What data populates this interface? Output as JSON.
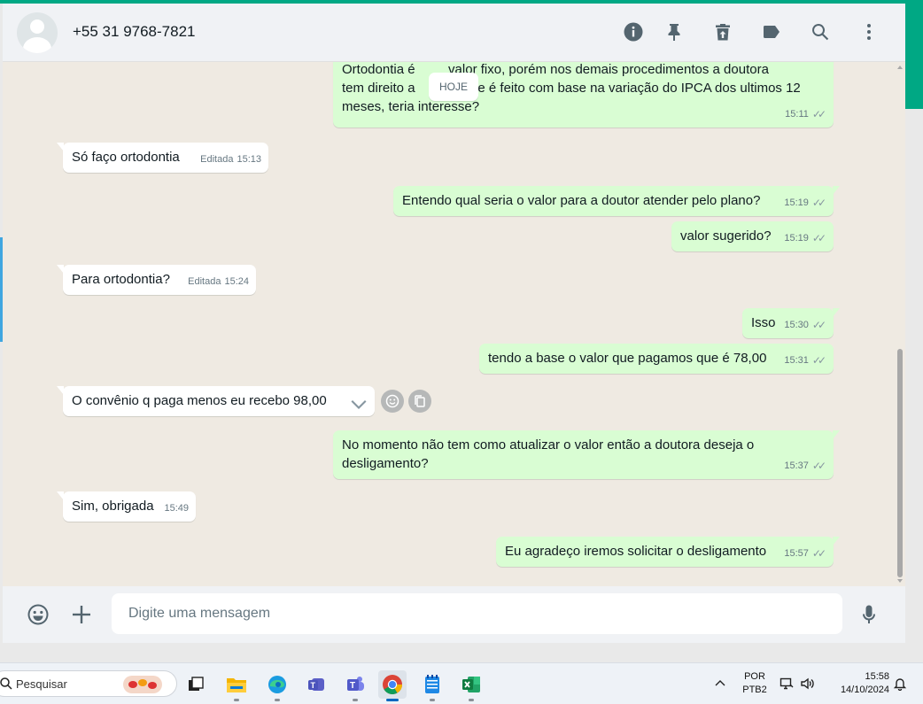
{
  "header": {
    "contact": "+55 31 9768-7821",
    "icons": [
      "info-icon",
      "pin-icon",
      "delete-icon",
      "label-icon",
      "search-icon",
      "menu-icon"
    ]
  },
  "chat": {
    "day_chip": "HOJE",
    "messages": [
      {
        "dir": "out",
        "text": "Ortodontia é         valor fixo, porém nos demais procedimentos a doutora\ntem direito a             que é feito com base na variação do IPCA dos ultimos 12\nmeses, teria interesse?",
        "time": "15:11",
        "status": "read"
      },
      {
        "dir": "in",
        "text": "Só faço ortodontia",
        "edited": "Editada",
        "time": "15:13"
      },
      {
        "dir": "out",
        "text": "Entendo qual seria o valor para a doutor atender pelo plano?",
        "time": "15:19",
        "status": "read"
      },
      {
        "dir": "out",
        "text": "valor sugerido?",
        "time": "15:19",
        "status": "read"
      },
      {
        "dir": "in",
        "text": "Para ortodontia?",
        "edited": "Editada",
        "time": "15:24"
      },
      {
        "dir": "out",
        "text": "Isso",
        "time": "15:30",
        "status": "read"
      },
      {
        "dir": "out",
        "text": "tendo a base o valor que pagamos que é 78,00",
        "time": "15:31",
        "status": "read"
      },
      {
        "dir": "in",
        "text": "O convênio q paga menos eu recebo 98,00",
        "time": "",
        "hover": true
      },
      {
        "dir": "out",
        "text": "No momento não tem como atualizar o valor então a doutora deseja o\ndesligamento?",
        "time": "15:37",
        "status": "read"
      },
      {
        "dir": "in",
        "text": "Sim, obrigada",
        "time": "15:49"
      },
      {
        "dir": "out",
        "text": "Eu agradeço iremos solicitar o desligamento",
        "time": "15:57",
        "status": "read"
      }
    ]
  },
  "composer": {
    "placeholder": "Digite uma mensagem",
    "icons": [
      "emoji-icon",
      "attach-plus-icon",
      "microphone-icon"
    ]
  },
  "taskbar": {
    "search_label": "Pesquisar",
    "apps": [
      "task-view",
      "file-explorer",
      "edge",
      "teams-classroom",
      "teams",
      "chrome",
      "notepad",
      "excel"
    ],
    "active_app": "chrome",
    "language": "POR",
    "keyboard": "PTB2",
    "time": "15:58",
    "date": "14/10/2024"
  },
  "colors": {
    "brand_green": "#00a884",
    "outgoing_bubble": "#d9fdd3",
    "incoming_bubble": "#ffffff",
    "chat_bg": "#efeae2",
    "panel_bg": "#f0f2f5"
  }
}
